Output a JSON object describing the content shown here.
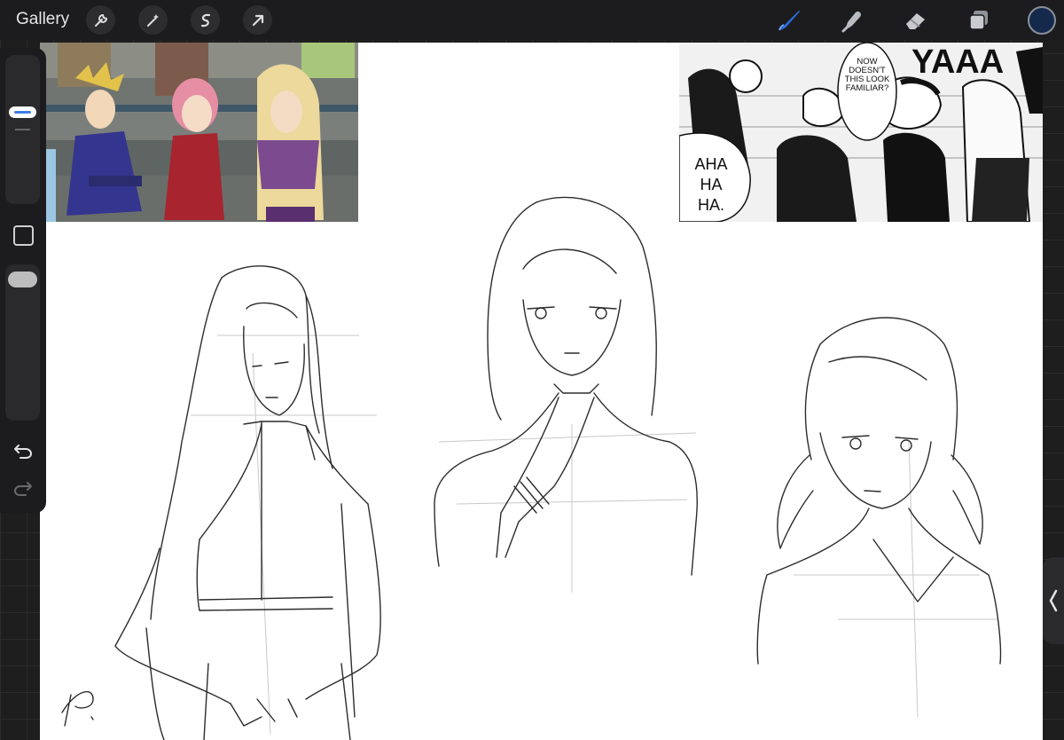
{
  "toolbar": {
    "gallery_label": "Gallery",
    "left_tools": [
      "wrench-icon",
      "magic-wand-icon",
      "selection-icon",
      "transform-arrow-icon"
    ],
    "right_tools": [
      "brush-icon",
      "smudge-icon",
      "eraser-icon",
      "layers-icon"
    ],
    "active_tool": "brush-icon",
    "brush_color": "#2b6fe0",
    "current_color": "#15294d"
  },
  "sidebar": {
    "controls": [
      "brush-size-slider",
      "modify-button",
      "opacity-slider",
      "undo-button",
      "redo-button"
    ],
    "accent": "#3f7ce8"
  },
  "canvas": {
    "references": {
      "anime_screenshot": "anime reference image",
      "manga_panel": {
        "bubble_1": [
          "NOW",
          "DOESN'T",
          "THIS LOOK",
          "FAMILIAR?"
        ],
        "bubble_2": [
          "AHA",
          "HA",
          "HA."
        ],
        "shout": "YAAA"
      }
    },
    "signature": "P."
  }
}
